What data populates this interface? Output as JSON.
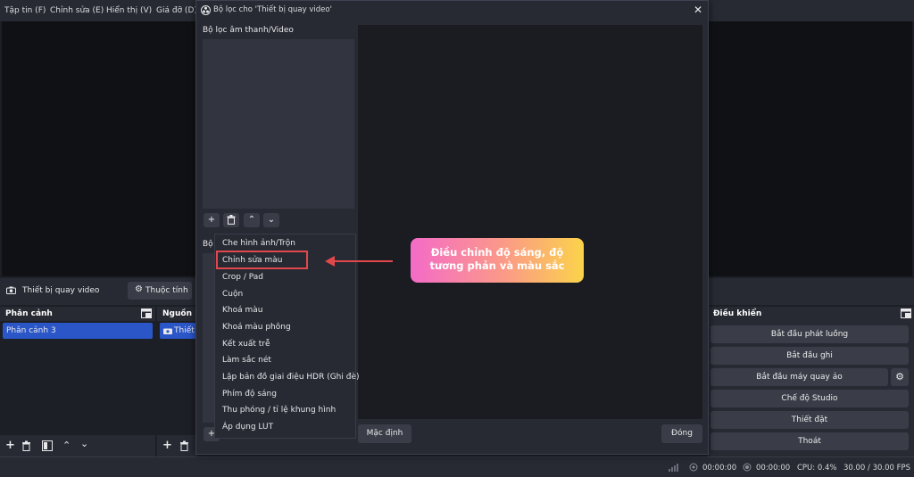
{
  "menu": {
    "file": "Tập tin (F)",
    "edit": "Chỉnh sửa (E)",
    "view": "Hiển thị (V)",
    "dock": "Giá đỡ (D)"
  },
  "source_toolbar": {
    "source_name": "Thiết bị quay video",
    "properties_label": "Thuộc tính"
  },
  "scenes": {
    "header": "Phân cảnh",
    "items": [
      "Phân cảnh 3"
    ]
  },
  "sources": {
    "header": "Nguồn",
    "items": [
      "Thiết"
    ]
  },
  "controls": {
    "header": "Điều khiển",
    "start_streaming": "Bắt đầu phát luồng",
    "start_recording": "Bắt đầu ghi",
    "start_virtual_cam": "Bắt đầu máy quay ảo",
    "studio_mode": "Chế độ Studio",
    "settings": "Thiết đặt",
    "exit": "Thoát"
  },
  "status": {
    "stream_time": "00:00:00",
    "record_time": "00:00:00",
    "cpu": "CPU: 0.4%",
    "fps": "30.00 / 30.00 FPS"
  },
  "dialog": {
    "title": "Bộ lọc cho 'Thiết bị quay video'",
    "audio_video_filters_label": "Bộ lọc âm thanh/Video",
    "effect_filters_label": "Bộ",
    "defaults_button": "Mặc định",
    "close_button": "Đóng",
    "filter_menu": [
      "Che hình ảnh/Trộn",
      "Chỉnh sửa màu",
      "Crop / Pad",
      "Cuộn",
      "Khoá màu",
      "Khoá màu phông",
      "Kết xuất trễ",
      "Làm sắc nét",
      "Lập bản đồ giai điệu HDR (Ghi đè)",
      "Phím độ sáng",
      "Thu phóng / tỉ lệ khung hình",
      "Áp dụng LUT"
    ]
  },
  "annotation": {
    "line1": "Điều chỉnh độ sáng, độ",
    "line2": "tương phản và màu sắc",
    "highlight_color": "#e2474b",
    "gradient": [
      "#f46bc8",
      "#fb9b86",
      "#fbd34a"
    ]
  },
  "colors": {
    "accent_selected": "#2a56c8",
    "panel": "#272a33",
    "background": "#1d1f26"
  }
}
